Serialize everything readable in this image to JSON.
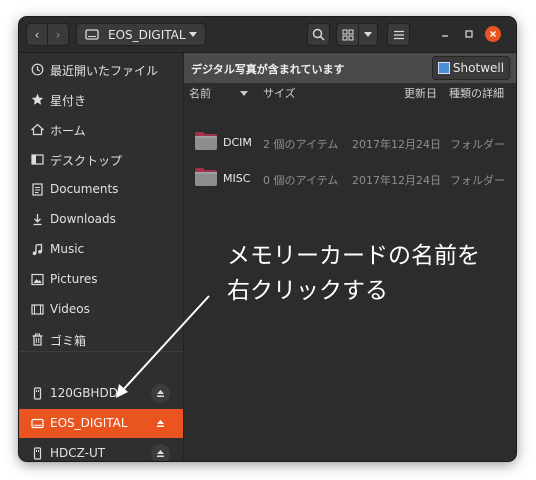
{
  "headerbar": {
    "path_label": "EOS_DIGITAL",
    "icons": [
      "go-back-icon",
      "go-forward-icon",
      "drive-icon",
      "search-icon",
      "grid-view-icon",
      "menu-icon",
      "minimize-icon",
      "maximize-icon",
      "close-icon"
    ]
  },
  "sidebar": {
    "items": [
      {
        "label": "最近開いたファイル",
        "icon": "clock-icon"
      },
      {
        "label": "星付き",
        "icon": "star-icon"
      },
      {
        "label": "ホーム",
        "icon": "home-icon"
      },
      {
        "label": "デスクトップ",
        "icon": "desktop-icon"
      },
      {
        "label": "Documents",
        "icon": "document-icon"
      },
      {
        "label": "Downloads",
        "icon": "download-icon"
      },
      {
        "label": "Music",
        "icon": "music-icon"
      },
      {
        "label": "Pictures",
        "icon": "picture-icon"
      },
      {
        "label": "Videos",
        "icon": "video-icon"
      },
      {
        "label": "ゴミ箱",
        "icon": "trash-icon"
      }
    ],
    "devices": [
      {
        "label": "120GBHDD",
        "icon": "usb-drive-icon",
        "eject": true
      },
      {
        "label": "EOS_DIGITAL",
        "icon": "drive-icon",
        "eject": true,
        "selected": true
      },
      {
        "label": "HDCZ-UT",
        "icon": "usb-drive-icon",
        "eject": true
      }
    ]
  },
  "infobar": {
    "message": "デジタル写真が含まれています",
    "button_label": "Shotwell"
  },
  "columns": {
    "name": "名前",
    "size": "サイズ",
    "modified": "更新日",
    "type": "種類の詳細"
  },
  "files": [
    {
      "name": "DCIM",
      "size": "2 個のアイテム",
      "modified": "2017年12月24日",
      "type": "フォルダー"
    },
    {
      "name": "MISC",
      "size": "0 個のアイテム",
      "modified": "2017年12月24日",
      "type": "フォルダー"
    }
  ],
  "annotation": {
    "line1": "メモリーカードの名前を",
    "line2": "右クリックする"
  },
  "colors": {
    "accent": "#e95420",
    "folder": "#8e8e8e",
    "folder_tab": "#a2324a"
  }
}
